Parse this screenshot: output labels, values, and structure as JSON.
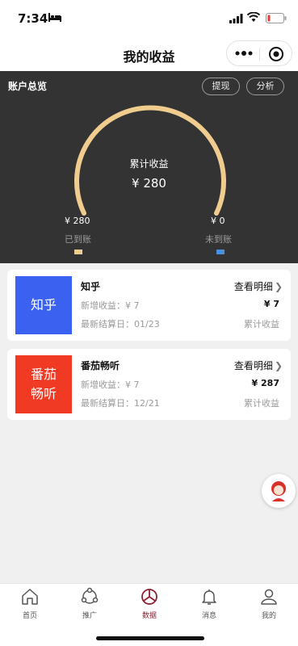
{
  "status": {
    "time": "7:34"
  },
  "nav": {
    "title": "我的收益"
  },
  "overview": {
    "title": "账户总览",
    "withdraw_label": "提现",
    "analysis_label": "分析",
    "total_label": "累计收益",
    "total_value": "¥ 280",
    "settled_value": "¥ 280",
    "unsettled_value": "¥ 0",
    "settled_label": "已到账",
    "unsettled_label": "未到账",
    "settled_fraction": 1.0,
    "colors": {
      "settled": "#f0cd8e",
      "unsettled": "#4a90e2"
    }
  },
  "cards": [
    {
      "logo_text": "知乎",
      "name": "知乎",
      "new_income": "新增收益：¥ 7",
      "last_settle": "最新结算日：01/23",
      "detail_label": "查看明细",
      "total": "¥ 7",
      "total_label": "累计收益",
      "color": "#3b61f1"
    },
    {
      "logo_text": "番茄畅听",
      "name": "番茄畅听",
      "new_income": "新增收益：¥ 7",
      "last_settle": "最新结算日：12/21",
      "detail_label": "查看明细",
      "total": "¥ 287",
      "total_label": "累计收益",
      "color": "#f03a24"
    }
  ],
  "tabbar": {
    "items": [
      {
        "label": "首页",
        "icon": "home-icon"
      },
      {
        "label": "推广",
        "icon": "share-icon"
      },
      {
        "label": "数据",
        "icon": "pie-chart-icon",
        "active": true
      },
      {
        "label": "消息",
        "icon": "bell-icon"
      },
      {
        "label": "我的",
        "icon": "user-icon"
      }
    ],
    "active_color": "#8b2232"
  }
}
